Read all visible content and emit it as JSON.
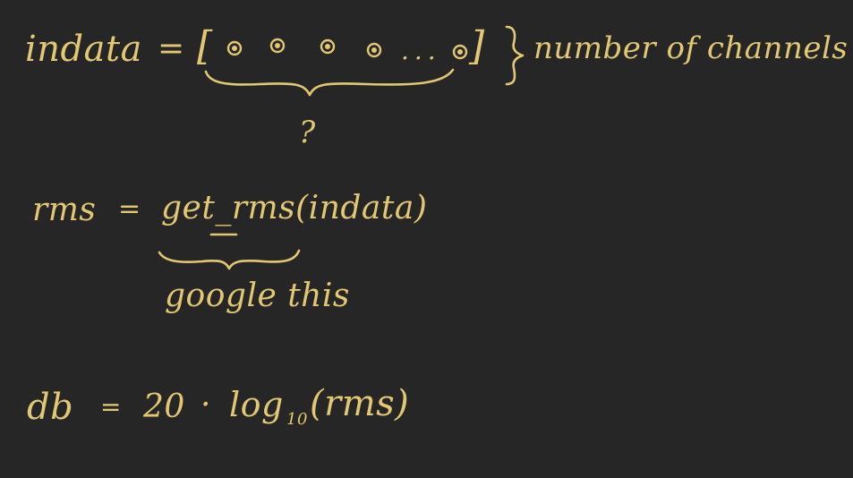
{
  "notes": {
    "indata_label": "indata",
    "equals_1": "=",
    "open_bracket": "[",
    "ellipsis": "...",
    "close_bracket": "]",
    "channels_label": "number of channels",
    "question_mark": "?",
    "rms_label": "rms",
    "equals_2": "=",
    "get_rms_call": "get_rms(indata)",
    "google_note": "google this",
    "db_label": "db",
    "equals_3": "=",
    "factor": "20",
    "dot_op": "·",
    "log_base": "log",
    "log_subscript": "10",
    "log_arg": "(rms)"
  },
  "colors": {
    "background": "#262626",
    "ink": "#e2c873"
  }
}
